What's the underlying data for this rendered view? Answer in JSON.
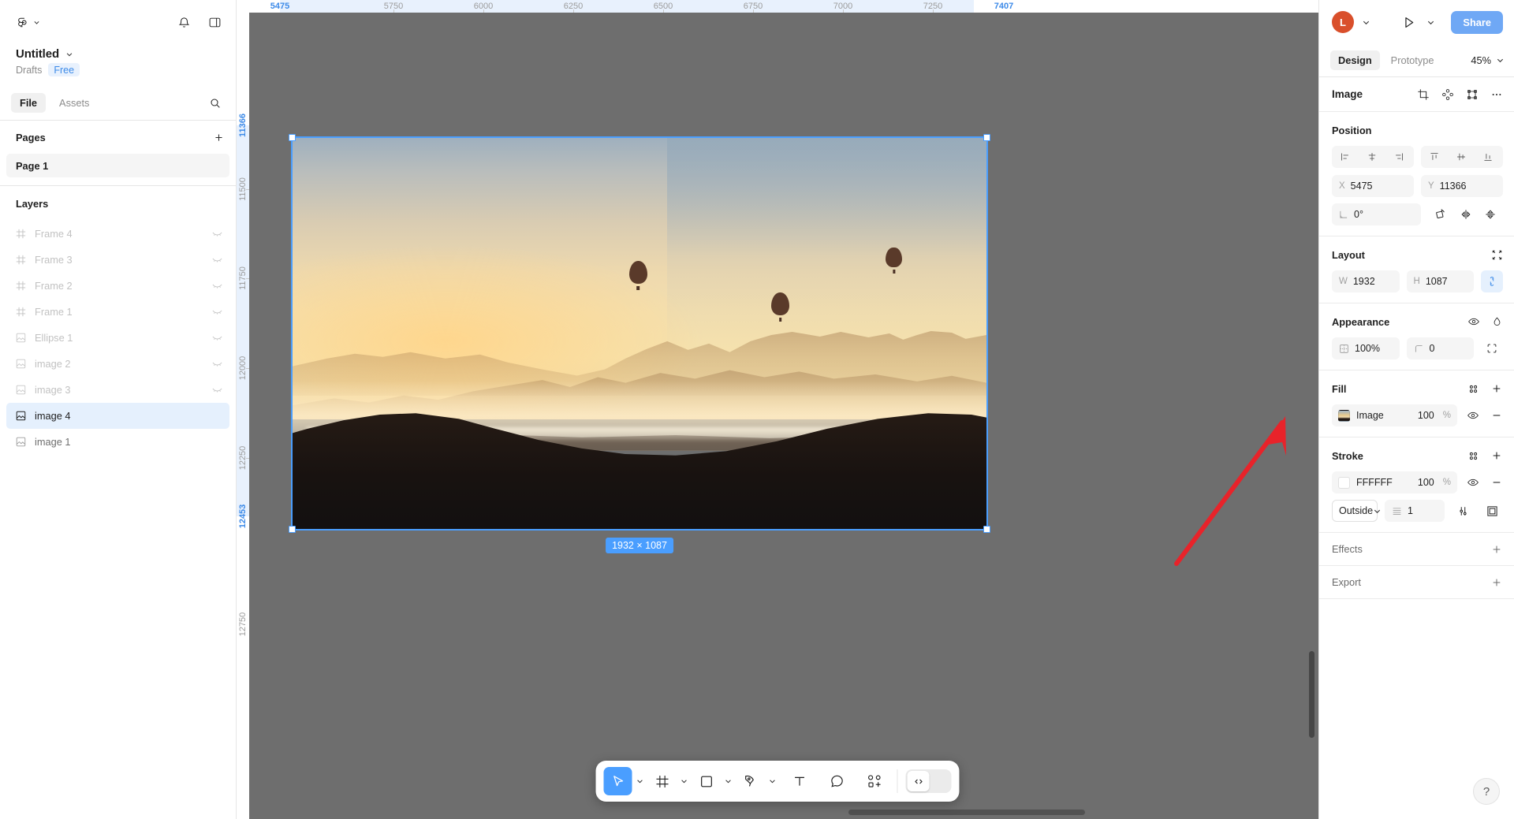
{
  "left_panel": {
    "logo_icon": "figma-logo-icon",
    "menu_caret_icon": "chevron-down-icon",
    "notifications_icon": "bell-icon",
    "layout_toggle_icon": "panel-toggle-icon",
    "file_title": "Untitled",
    "file_title_caret_icon": "chevron-down-icon",
    "breadcrumb_drafts": "Drafts",
    "plan_badge": "Free",
    "tabs": [
      {
        "label": "File",
        "active": true
      },
      {
        "label": "Assets",
        "active": false
      }
    ],
    "search_icon": "search-icon",
    "pages": {
      "title": "Pages",
      "add_icon": "plus-icon",
      "items": [
        {
          "label": "Page 1",
          "selected": true
        }
      ]
    },
    "layers": {
      "title": "Layers",
      "items": [
        {
          "label": "Frame 4",
          "icon": "frame-icon",
          "selected": false,
          "hidden": true
        },
        {
          "label": "Frame 3",
          "icon": "frame-icon",
          "selected": false,
          "hidden": true
        },
        {
          "label": "Frame 2",
          "icon": "frame-icon",
          "selected": false,
          "hidden": true
        },
        {
          "label": "Frame 1",
          "icon": "frame-icon",
          "selected": false,
          "hidden": true
        },
        {
          "label": "Ellipse 1",
          "icon": "image-icon",
          "selected": false,
          "hidden": true
        },
        {
          "label": "image 2",
          "icon": "image-icon",
          "selected": false,
          "hidden": true
        },
        {
          "label": "image 3",
          "icon": "image-icon",
          "selected": false,
          "hidden": true
        },
        {
          "label": "image 4",
          "icon": "image-icon",
          "selected": true,
          "hidden": false
        },
        {
          "label": "image 1",
          "icon": "image-icon",
          "selected": false,
          "hidden": false
        }
      ],
      "visibility_icon": "eye-closed-icon"
    }
  },
  "canvas": {
    "ruler_h": [
      {
        "label": "5475",
        "highlight": true
      },
      {
        "label": "5750",
        "highlight": false
      },
      {
        "label": "6000",
        "highlight": false
      },
      {
        "label": "6250",
        "highlight": false
      },
      {
        "label": "6500",
        "highlight": false
      },
      {
        "label": "6750",
        "highlight": false
      },
      {
        "label": "7000",
        "highlight": false
      },
      {
        "label": "7250",
        "highlight": false
      },
      {
        "label": "7407",
        "highlight": true
      }
    ],
    "ruler_v": [
      {
        "label": "11366",
        "highlight": true
      },
      {
        "label": "11500",
        "highlight": false
      },
      {
        "label": "11750",
        "highlight": false
      },
      {
        "label": "12000",
        "highlight": false
      },
      {
        "label": "12250",
        "highlight": false
      },
      {
        "label": "12453",
        "highlight": true
      },
      {
        "label": "12750",
        "highlight": false
      }
    ],
    "selection_size_badge": "1932 × 1087",
    "selection_color": "#4a9eff",
    "annotation_arrow_color": "#e8232a"
  },
  "toolbar": {
    "items": [
      {
        "name": "move-tool",
        "icon": "cursor-icon",
        "active": true,
        "caret": true
      },
      {
        "name": "frame-tool",
        "icon": "frame-icon",
        "active": false,
        "caret": true
      },
      {
        "name": "shape-tool",
        "icon": "square-icon",
        "active": false,
        "caret": true
      },
      {
        "name": "pen-tool",
        "icon": "pen-icon",
        "active": false,
        "caret": true
      },
      {
        "name": "text-tool",
        "icon": "text-icon",
        "active": false,
        "caret": false
      },
      {
        "name": "comment-tool",
        "icon": "comment-icon",
        "active": false,
        "caret": false
      },
      {
        "name": "actions-tool",
        "icon": "components-icon",
        "active": false,
        "caret": false
      }
    ],
    "code_toggle_icon": "code-icon"
  },
  "right_panel": {
    "avatar_initial": "L",
    "avatar_caret_icon": "chevron-down-icon",
    "present_icon": "play-icon",
    "present_caret_icon": "chevron-down-icon",
    "share_label": "Share",
    "tabs": [
      {
        "label": "Design",
        "active": true
      },
      {
        "label": "Prototype",
        "active": false
      }
    ],
    "zoom_value": "45%",
    "zoom_caret_icon": "chevron-down-icon",
    "object_type": "Image",
    "object_icons": [
      "crop-icon",
      "components-icon",
      "selection-icon",
      "more-icon"
    ],
    "position": {
      "title": "Position",
      "align_left_icon": "align-left-icon",
      "align_h_center_icon": "align-horizontal-center-icon",
      "align_right_icon": "align-right-icon",
      "align_top_icon": "align-top-icon",
      "align_v_center_icon": "align-vertical-center-icon",
      "align_bottom_icon": "align-bottom-icon",
      "x_label": "X",
      "x_value": "5475",
      "y_label": "Y",
      "y_value": "11366",
      "rotation_icon": "angle-icon",
      "rotation_value": "0°",
      "flip_rotate_icon": "rotate-icon",
      "flip_horizontal_icon": "flip-horizontal-icon",
      "flip_vertical_icon": "flip-vertical-icon"
    },
    "layout": {
      "title": "Layout",
      "resize_icon": "resize-to-fit-icon",
      "w_label": "W",
      "w_value": "1932",
      "h_label": "H",
      "h_value": "1087",
      "constrain_icon": "link-icon",
      "constrain_active": true
    },
    "appearance": {
      "title": "Appearance",
      "visibility_icon": "eye-icon",
      "blend_icon": "blend-mode-icon",
      "opacity_icon": "opacity-icon",
      "opacity_value": "100%",
      "corner_icon": "corner-radius-icon",
      "corner_value": "0",
      "independent_corners_icon": "independent-corners-icon"
    },
    "fill": {
      "title": "Fill",
      "styles_icon": "styles-icon",
      "add_icon": "plus-icon",
      "swatch_type": "image-swatch",
      "name": "Image",
      "opacity": "100",
      "percent_sign": "%",
      "visibility_icon": "eye-icon",
      "remove_icon": "minus-icon"
    },
    "stroke": {
      "title": "Stroke",
      "styles_icon": "styles-icon",
      "add_icon": "plus-icon",
      "swatch_color": "#FFFFFF",
      "hex": "FFFFFF",
      "opacity": "100",
      "percent_sign": "%",
      "visibility_icon": "eye-icon",
      "remove_icon": "minus-icon",
      "align_value": "Outside",
      "align_caret_icon": "chevron-down-icon",
      "weight_icon": "stroke-weight-icon",
      "weight_value": "1",
      "advanced_icon": "sliders-icon",
      "per_side_icon": "stroke-sides-icon"
    },
    "effects": {
      "title": "Effects",
      "add_icon": "plus-icon"
    },
    "export": {
      "title": "Export",
      "add_icon": "plus-icon"
    },
    "help_label": "?"
  }
}
